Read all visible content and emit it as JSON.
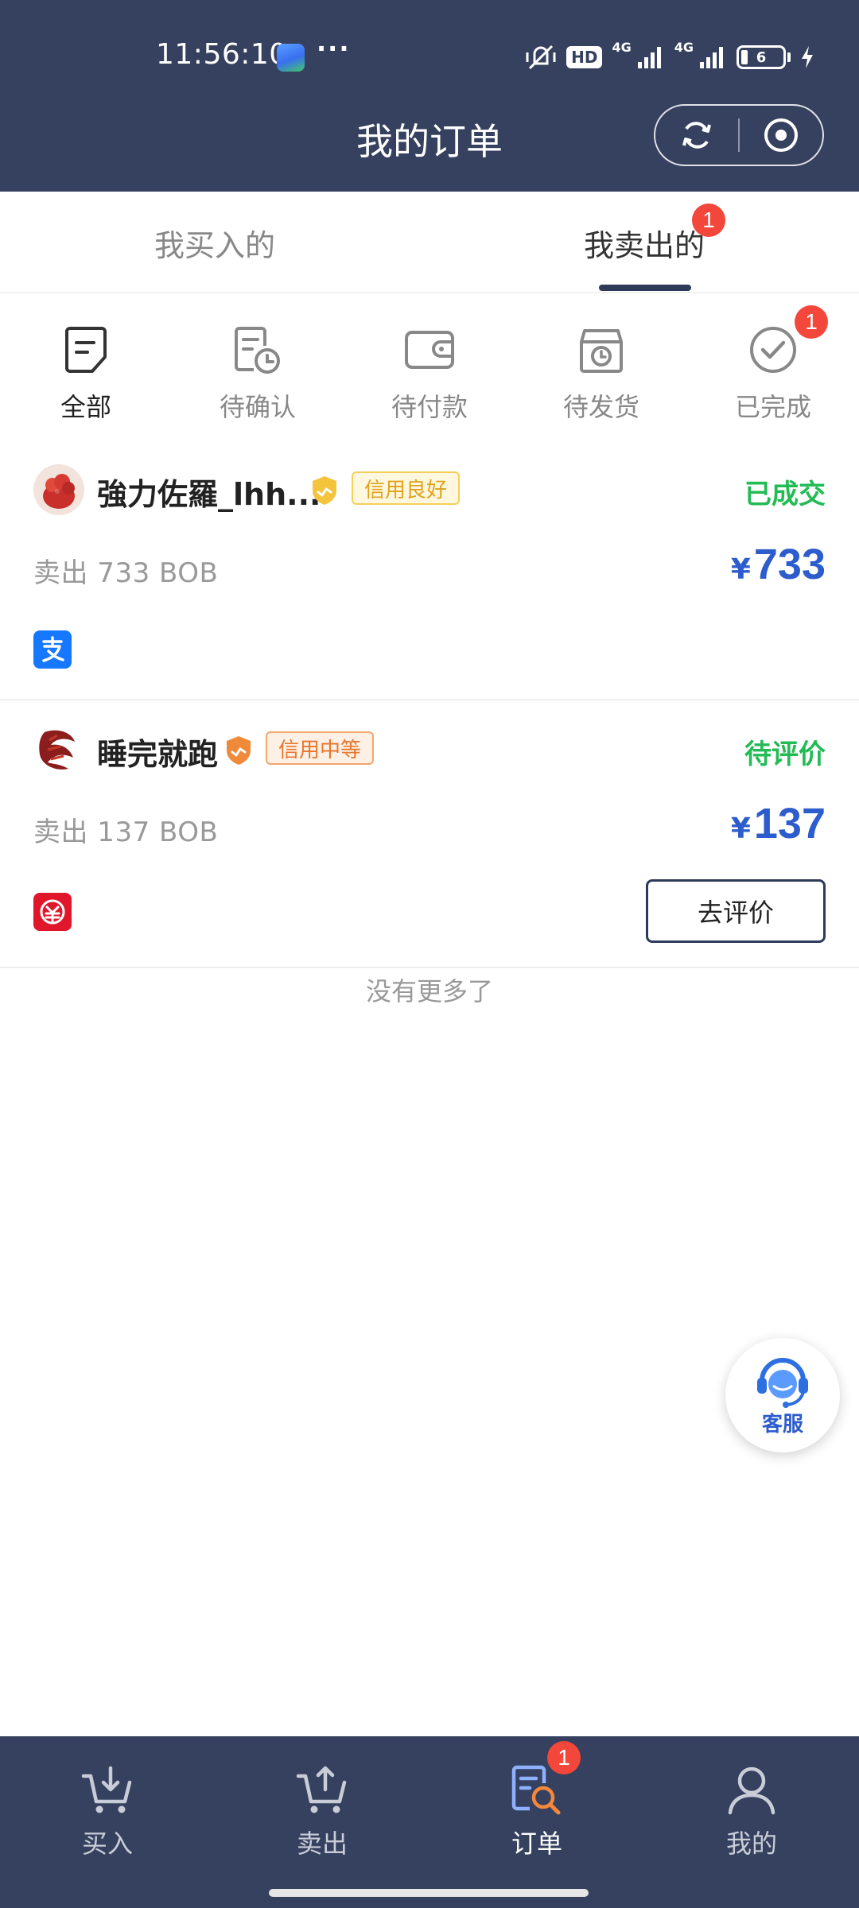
{
  "status_bar": {
    "time": "11:56:10",
    "more": "···",
    "hd": "HD",
    "net1": "4G",
    "net2": "4G",
    "battery": "6"
  },
  "header": {
    "title": "我的订单"
  },
  "tabs": [
    {
      "label": "我买入的",
      "active": false
    },
    {
      "label": "我卖出的",
      "active": true,
      "badge": "1"
    }
  ],
  "filters": [
    {
      "label": "全部",
      "icon": "document-icon",
      "active": true
    },
    {
      "label": "待确认",
      "icon": "document-clock-icon"
    },
    {
      "label": "待付款",
      "icon": "wallet-icon"
    },
    {
      "label": "待发货",
      "icon": "package-clock-icon"
    },
    {
      "label": "已完成",
      "icon": "check-circle-icon",
      "badge": "1"
    }
  ],
  "orders": [
    {
      "seller": "強力佐羅_lhh...",
      "credit": "信用良好",
      "status": "已成交",
      "desc": "卖出 733 BOB",
      "currency": "¥",
      "price": "733",
      "payment_icon": "alipay-icon"
    },
    {
      "seller": "睡完就跑",
      "credit": "信用中等",
      "status": "待评价",
      "desc": "卖出 137 BOB",
      "currency": "¥",
      "price": "137",
      "payment_icon": "unionpay-icon",
      "action": "去评价"
    }
  ],
  "footer_text": "没有更多了",
  "customer_service": {
    "label": "客服"
  },
  "bottom_nav": [
    {
      "label": "买入",
      "icon": "cart-download-icon"
    },
    {
      "label": "卖出",
      "icon": "cart-upload-icon"
    },
    {
      "label": "订单",
      "icon": "order-search-icon",
      "active": true,
      "badge": "1"
    },
    {
      "label": "我的",
      "icon": "person-icon"
    }
  ],
  "colors": {
    "header_bg": "#36415f",
    "status_green": "#22bb55",
    "price_blue": "#2d5ccc",
    "badge_red": "#f2473a"
  }
}
